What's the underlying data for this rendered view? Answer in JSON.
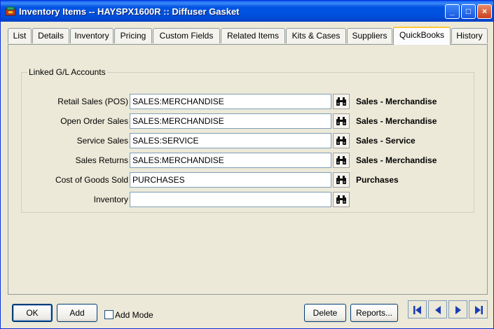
{
  "window": {
    "title": "Inventory Items -- HAYSPX1600R :: Diffuser Gasket",
    "minimize_glyph": "_",
    "maximize_glyph": "□",
    "close_glyph": "×"
  },
  "tabs": [
    {
      "label": "List",
      "active": false
    },
    {
      "label": "Details",
      "active": false
    },
    {
      "label": "Inventory",
      "active": false
    },
    {
      "label": "Pricing",
      "active": false
    },
    {
      "label": "Custom Fields",
      "active": false
    },
    {
      "label": "Related Items",
      "active": false
    },
    {
      "label": "Kits & Cases",
      "active": false
    },
    {
      "label": "Suppliers",
      "active": false
    },
    {
      "label": "QuickBooks",
      "active": true
    },
    {
      "label": "History",
      "active": false
    }
  ],
  "gl_accounts": {
    "legend": "Linked G/L Accounts",
    "rows": [
      {
        "label": "Retail Sales (POS)",
        "value": "SALES:MERCHANDISE",
        "description": "Sales - Merchandise"
      },
      {
        "label": "Open Order Sales",
        "value": "SALES:MERCHANDISE",
        "description": "Sales - Merchandise"
      },
      {
        "label": "Service Sales",
        "value": "SALES:SERVICE",
        "description": "Sales - Service"
      },
      {
        "label": "Sales Returns",
        "value": "SALES:MERCHANDISE",
        "description": "Sales - Merchandise"
      },
      {
        "label": "Cost of Goods Sold",
        "value": "PURCHASES",
        "description": "Purchases"
      },
      {
        "label": "Inventory",
        "value": "",
        "description": ""
      }
    ]
  },
  "footer": {
    "ok_label": "OK",
    "add_label": "Add",
    "add_mode_label": "Add Mode",
    "add_mode_checked": false,
    "delete_label": "Delete",
    "reports_label": "Reports..."
  },
  "icons": {
    "app": "inventory-app-icon",
    "find": "binoculars-icon",
    "nav": [
      "first-record-icon",
      "previous-record-icon",
      "next-record-icon",
      "last-record-icon"
    ]
  },
  "colors": {
    "titlebar": "#0054e3",
    "active_tab_accent": "#ffc83c",
    "nav_arrow": "#1a3cb4"
  }
}
